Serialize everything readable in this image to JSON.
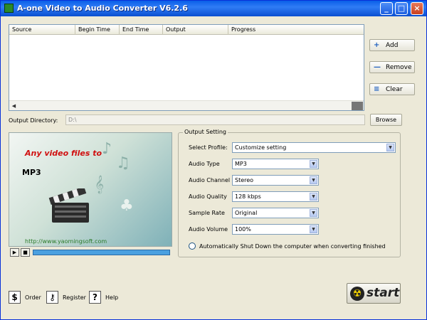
{
  "window": {
    "title": "A-one Video to Audio Converter V6.2.6",
    "icon": "app-icon",
    "controls": {
      "minimize": "_",
      "maximize": "□",
      "close": "×"
    }
  },
  "filelist": {
    "columns": [
      "Source",
      "Begin Time",
      "End Time",
      "Output",
      "Progress"
    ]
  },
  "side_buttons": {
    "add": "Add",
    "remove": "Remove",
    "clear": "Clear"
  },
  "output": {
    "label": "Output Directory:",
    "value": "D:\\",
    "browse": "Browse"
  },
  "preview": {
    "line1": "Any video files to",
    "line2": "MP3",
    "url": "http://www.yaomingsoft.com"
  },
  "settings": {
    "group_title": "Output Setting",
    "profile": {
      "label": "Select Profile:",
      "value": "Customize setting"
    },
    "audio_type": {
      "label": "Audio Type",
      "value": "MP3"
    },
    "audio_channel": {
      "label": "Audio Channel",
      "value": "Stereo"
    },
    "audio_quality": {
      "label": "Audio Quality",
      "value": "128  kbps"
    },
    "sample_rate": {
      "label": "Sample Rate",
      "value": "Original"
    },
    "audio_volume": {
      "label": "Audio Volume",
      "value": "100%"
    },
    "shutdown": "Automatically Shut Down the computer when converting finished"
  },
  "footer": {
    "order": "Order",
    "register": "Register",
    "help": "Help",
    "start": "start"
  },
  "colors": {
    "titlebar": "#0a5fe8",
    "window_bg": "#ece9d8",
    "preview_red": "#d01010",
    "seek_blue": "#4aa0e0"
  }
}
